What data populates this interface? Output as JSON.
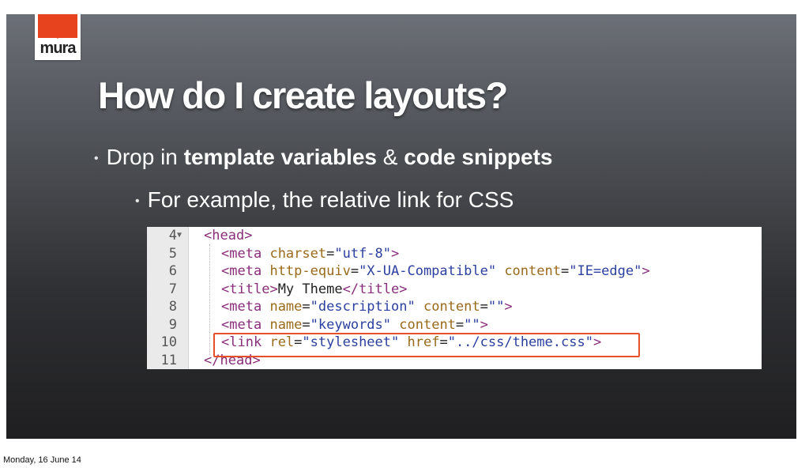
{
  "logo": {
    "text": "mura",
    "brand_color": "#e8431f"
  },
  "slide": {
    "title": "How do I create layouts?",
    "bullets": [
      {
        "prefix": "Drop in ",
        "bold1": "template variables",
        "mid": " & ",
        "bold2": "code snippets"
      },
      {
        "text": "For example, the relative link for CSS"
      }
    ]
  },
  "code": {
    "lines": [
      {
        "num": "4",
        "fold": "▼",
        "open": "<",
        "tag": "head",
        "close": ">"
      },
      {
        "num": "5",
        "open": "<",
        "tag": "meta",
        "a1": "charset",
        "eq1": "=",
        "v1": "\"utf-8\"",
        "close": ">"
      },
      {
        "num": "6",
        "open": "<",
        "tag": "meta",
        "a1": "http-equiv",
        "eq1": "=",
        "v1": "\"X-UA-Compatible\"",
        "a2": "content",
        "eq2": "=",
        "v2": "\"IE=edge\"",
        "close": ">"
      },
      {
        "num": "7",
        "open": "<",
        "tag": "title",
        "close": ">",
        "text": "My Theme",
        "endopen": "</",
        "endtag": "title",
        "endclose": ">"
      },
      {
        "num": "8",
        "open": "<",
        "tag": "meta",
        "a1": "name",
        "eq1": "=",
        "v1": "\"description\"",
        "a2": "content",
        "eq2": "=",
        "v2": "\"\"",
        "close": ">"
      },
      {
        "num": "9",
        "open": "<",
        "tag": "meta",
        "a1": "name",
        "eq1": "=",
        "v1": "\"keywords\"",
        "a2": "content",
        "eq2": "=",
        "v2": "\"\"",
        "close": ">"
      },
      {
        "num": "10",
        "open": "<",
        "tag": "link",
        "a1": "rel",
        "eq1": "=",
        "v1": "\"stylesheet\"",
        "a2": "href",
        "eq2": "=",
        "v2": "\"../css/theme.css\"",
        "close": ">"
      },
      {
        "num": "11",
        "open": "</",
        "tag": "head",
        "close": ">"
      }
    ],
    "highlight_color": "#e8502b"
  },
  "footer": {
    "date": "Monday, 16 June 14"
  }
}
